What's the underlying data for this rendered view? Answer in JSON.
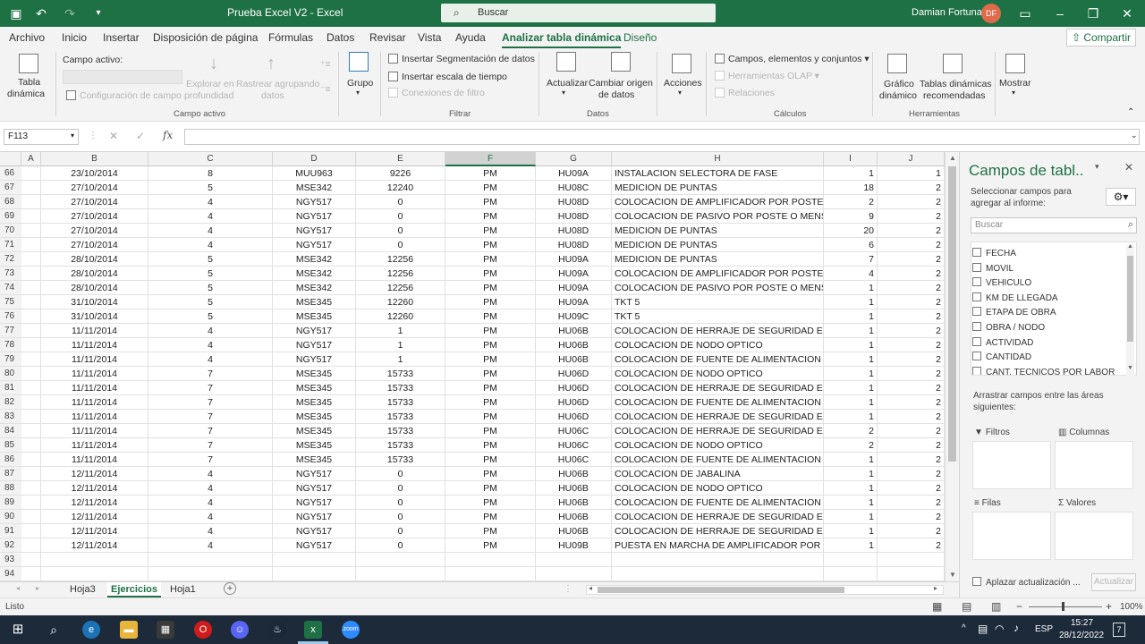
{
  "titlebar": {
    "title": "Prueba Excel V2  -  Excel",
    "search_placeholder": "Buscar",
    "user": "Damian Fortuna",
    "user_initials": "DF"
  },
  "menu": {
    "tabs": [
      "Archivo",
      "Inicio",
      "Insertar",
      "Disposición de página",
      "Fórmulas",
      "Datos",
      "Revisar",
      "Vista",
      "Ayuda",
      "Analizar tabla dinámica",
      "Diseño"
    ],
    "active_tab": "Analizar tabla dinámica",
    "share": "Compartir"
  },
  "ribbon": {
    "tabla_dinamica": "Tabla",
    "tabla_dinamica2": "dinámica",
    "campo_activo": "Campo activo:",
    "configuracion_campo": "Configuración de campo",
    "explorar": "Explorar en",
    "explorar2": "profundidad",
    "rastrear": "Rastrear agrupando",
    "rastrear2": "datos",
    "group_campo_activo": "Campo activo",
    "grupo": "Grupo",
    "insertar_segmentacion": "Insertar Segmentación de datos",
    "insertar_escala": "Insertar escala de tiempo",
    "conexiones_filtro": "Conexiones de filtro",
    "group_filtrar": "Filtrar",
    "actualizar": "Actualizar",
    "cambiar_origen": "Cambiar origen",
    "cambiar_origen2": "de datos",
    "group_datos": "Datos",
    "acciones": "Acciones",
    "campos_elementos": "Campos, elementos y conjuntos",
    "herramientas_olap": "Herramientas OLAP",
    "relaciones": "Relaciones",
    "group_calculos": "Cálculos",
    "grafico_dinamico": "Gráfico",
    "grafico_dinamico2": "dinámico",
    "tablas_recomendadas": "Tablas dinámicas",
    "tablas_recomendadas2": "recomendadas",
    "group_herramientas": "Herramientas",
    "mostrar": "Mostrar"
  },
  "formula": {
    "namebox": "F113",
    "content": ""
  },
  "columns": [
    "A",
    "B",
    "C",
    "D",
    "E",
    "F",
    "G",
    "H",
    "I",
    "J"
  ],
  "selected_column": "F",
  "rows": [
    [
      "66",
      "23/10/2014",
      "8",
      "MUU963",
      "9226",
      "PM",
      "HU09A",
      "INSTALACION SELECTORA DE FASE",
      "1",
      "1"
    ],
    [
      "67",
      "27/10/2014",
      "5",
      "MSE342",
      "12240",
      "PM",
      "HU08C",
      "MEDICION DE PUNTAS",
      "18",
      "2"
    ],
    [
      "68",
      "27/10/2014",
      "4",
      "NGY517",
      "0",
      "PM",
      "HU08D",
      "COLOCACION DE AMPLIFICADOR POR POSTE MI",
      "2",
      "2"
    ],
    [
      "69",
      "27/10/2014",
      "4",
      "NGY517",
      "0",
      "PM",
      "HU08D",
      "COLOCACION DE PASIVO POR POSTE O MENSUL",
      "9",
      "2"
    ],
    [
      "70",
      "27/10/2014",
      "4",
      "NGY517",
      "0",
      "PM",
      "HU08D",
      "MEDICION DE PUNTAS",
      "20",
      "2"
    ],
    [
      "71",
      "27/10/2014",
      "4",
      "NGY517",
      "0",
      "PM",
      "HU08D",
      "MEDICION DE PUNTAS",
      "6",
      "2"
    ],
    [
      "72",
      "28/10/2014",
      "5",
      "MSE342",
      "12256",
      "PM",
      "HU09A",
      "MEDICION DE PUNTAS",
      "7",
      "2"
    ],
    [
      "73",
      "28/10/2014",
      "5",
      "MSE342",
      "12256",
      "PM",
      "HU09A",
      "COLOCACION DE AMPLIFICADOR POR POSTE MI",
      "4",
      "2"
    ],
    [
      "74",
      "28/10/2014",
      "5",
      "MSE342",
      "12256",
      "PM",
      "HU09A",
      "COLOCACION DE PASIVO POR POSTE O MENSUL",
      "1",
      "2"
    ],
    [
      "75",
      "31/10/2014",
      "5",
      "MSE345",
      "12260",
      "PM",
      "HU09A",
      "TKT 5",
      "1",
      "2"
    ],
    [
      "76",
      "31/10/2014",
      "5",
      "MSE345",
      "12260",
      "PM",
      "HU09C",
      "TKT 5",
      "1",
      "2"
    ],
    [
      "77",
      "11/11/2014",
      "4",
      "NGY517",
      "1",
      "PM",
      "HU06B",
      "COLOCACION DE HERRAJE DE SEGURIDAD EN A",
      "1",
      "2"
    ],
    [
      "78",
      "11/11/2014",
      "4",
      "NGY517",
      "1",
      "PM",
      "HU06B",
      "COLOCACION DE NODO OPTICO",
      "1",
      "2"
    ],
    [
      "79",
      "11/11/2014",
      "4",
      "NGY517",
      "1",
      "PM",
      "HU06B",
      "COLOCACION DE FUENTE DE ALIMENTACION ST",
      "1",
      "2"
    ],
    [
      "80",
      "11/11/2014",
      "7",
      "MSE345",
      "15733",
      "PM",
      "HU06D",
      "COLOCACION DE NODO OPTICO",
      "1",
      "2"
    ],
    [
      "81",
      "11/11/2014",
      "7",
      "MSE345",
      "15733",
      "PM",
      "HU06D",
      "COLOCACION DE HERRAJE DE SEGURIDAD EN A",
      "1",
      "2"
    ],
    [
      "82",
      "11/11/2014",
      "7",
      "MSE345",
      "15733",
      "PM",
      "HU06D",
      "COLOCACION DE FUENTE DE ALIMENTACION ST",
      "1",
      "2"
    ],
    [
      "83",
      "11/11/2014",
      "7",
      "MSE345",
      "15733",
      "PM",
      "HU06D",
      "COLOCACION DE HERRAJE DE SEGURIDAD EN A",
      "1",
      "2"
    ],
    [
      "84",
      "11/11/2014",
      "7",
      "MSE345",
      "15733",
      "PM",
      "HU06C",
      "COLOCACION DE HERRAJE DE SEGURIDAD EN A",
      "2",
      "2"
    ],
    [
      "85",
      "11/11/2014",
      "7",
      "MSE345",
      "15733",
      "PM",
      "HU06C",
      "COLOCACION DE NODO OPTICO",
      "2",
      "2"
    ],
    [
      "86",
      "11/11/2014",
      "7",
      "MSE345",
      "15733",
      "PM",
      "HU06C",
      "COLOCACION DE FUENTE DE ALIMENTACION ST",
      "1",
      "2"
    ],
    [
      "87",
      "12/11/2014",
      "4",
      "NGY517",
      "0",
      "PM",
      "HU06B",
      "COLOCACION DE JABALINA",
      "1",
      "2"
    ],
    [
      "88",
      "12/11/2014",
      "4",
      "NGY517",
      "0",
      "PM",
      "HU06B",
      "COLOCACION DE NODO OPTICO",
      "1",
      "2"
    ],
    [
      "89",
      "12/11/2014",
      "4",
      "NGY517",
      "0",
      "PM",
      "HU06B",
      "COLOCACION DE FUENTE DE ALIMENTACION ST",
      "1",
      "2"
    ],
    [
      "90",
      "12/11/2014",
      "4",
      "NGY517",
      "0",
      "PM",
      "HU06B",
      "COLOCACION DE HERRAJE DE SEGURIDAD EN A",
      "1",
      "2"
    ],
    [
      "91",
      "12/11/2014",
      "4",
      "NGY517",
      "0",
      "PM",
      "HU06B",
      "COLOCACION DE HERRAJE DE SEGURIDAD EN A",
      "1",
      "2"
    ],
    [
      "92",
      "12/11/2014",
      "4",
      "NGY517",
      "0",
      "PM",
      "HU09B",
      "PUESTA EN MARCHA DE AMPLIFICADOR POR PC",
      "1",
      "2"
    ],
    [
      "93",
      "",
      "",
      "",
      "",
      "",
      "",
      "",
      "",
      ""
    ],
    [
      "94",
      "",
      "",
      "",
      "",
      "",
      "",
      "",
      "",
      ""
    ]
  ],
  "sheets": [
    "Hoja3",
    "Ejercicios",
    "Hoja1"
  ],
  "active_sheet": "Ejercicios",
  "status": {
    "ready": "Listo",
    "zoom": "100%"
  },
  "pivot_panel": {
    "title": "Campos de tabl..",
    "subtitle": "Seleccionar campos para agregar al informe:",
    "search_placeholder": "Buscar",
    "fields": [
      "FECHA",
      "MOVIL",
      "VEHICULO",
      "KM DE LLEGADA",
      "ETAPA DE OBRA",
      "OBRA / NODO",
      "ACTIVIDAD",
      "CANTIDAD",
      "CANT. TECNICOS POR LABOR"
    ],
    "areas_label": "Arrastrar campos entre las áreas siguientes:",
    "area_filters": "Filtros",
    "area_columns": "Columnas",
    "area_rows": "Filas",
    "area_values": "Valores",
    "defer": "Aplazar actualización ...",
    "update": "Actualizar"
  },
  "taskbar": {
    "lang": "ESP",
    "time": "15:27",
    "date": "28/12/2022",
    "notifications": "7"
  },
  "colors": {
    "excel_green": "#1e7145"
  }
}
